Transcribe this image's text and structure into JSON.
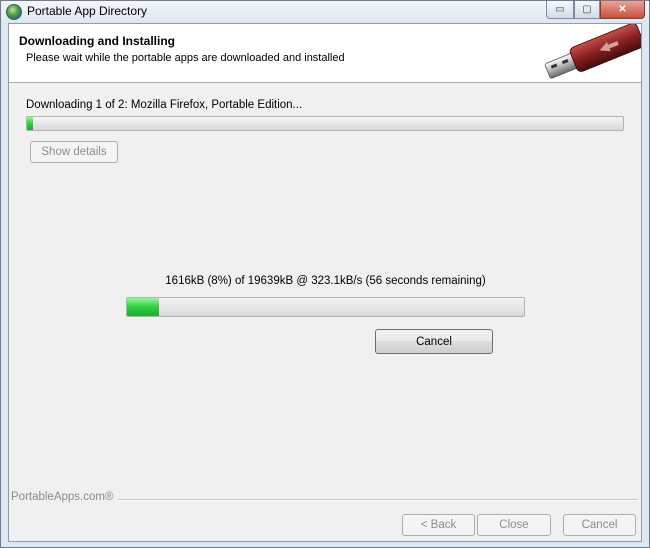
{
  "window": {
    "title": "Portable App Directory",
    "buttons": {
      "minimize": "▭",
      "maximize": "▢",
      "close": "✕"
    }
  },
  "header": {
    "title": "Downloading and Installing",
    "subtitle": "Please wait while the portable apps are downloaded and installed"
  },
  "overall": {
    "status": "Downloading 1 of 2: Mozilla Firefox, Portable Edition...",
    "progress_percent": 1,
    "show_details_label": "Show details"
  },
  "download": {
    "status": "1616kB (8%) of 19639kB @ 323.1kB/s (56 seconds remaining)",
    "progress_percent": 8,
    "cancel_label": "Cancel"
  },
  "footer": {
    "brand": "PortableApps.com®",
    "back_label": "< Back",
    "close_label": "Close",
    "cancel_label": "Cancel"
  },
  "colors": {
    "progress_fill": "#2fcc3f",
    "usb_drive_body": "#8a1f1f"
  }
}
